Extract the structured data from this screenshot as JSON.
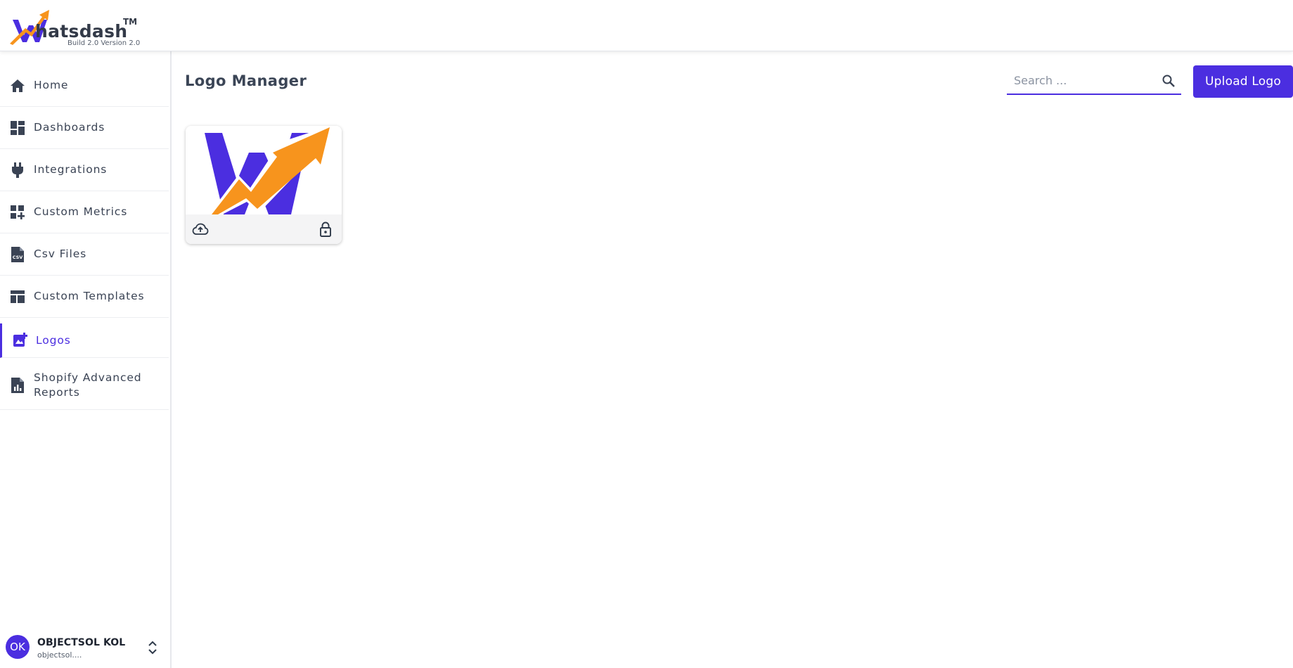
{
  "brand": {
    "name": "hatsdash",
    "tm": "TM",
    "build": "Build 2.0 Version 2.0",
    "colors": {
      "primary": "#4b2ee0",
      "accent": "#f7941d"
    }
  },
  "sidebar": {
    "items": [
      {
        "label": "Home",
        "icon": "home-icon"
      },
      {
        "label": "Dashboards",
        "icon": "dashboard-icon"
      },
      {
        "label": "Integrations",
        "icon": "plug-icon"
      },
      {
        "label": "Custom Metrics",
        "icon": "add-widget-icon"
      },
      {
        "label": "Csv Files",
        "icon": "csv-file-icon"
      },
      {
        "label": "Custom Templates",
        "icon": "template-icon"
      },
      {
        "label": "Logos",
        "icon": "logo-image-icon",
        "active": true
      },
      {
        "label": "Shopify Advanced Reports",
        "icon": "report-file-icon"
      }
    ]
  },
  "user": {
    "initials": "OK",
    "name": "OBJECTSOL KOL",
    "email": "objectsol...."
  },
  "main": {
    "title": "Logo Manager",
    "search": {
      "placeholder": "Search ..."
    },
    "upload_label": "Upload Logo",
    "logos": [
      {
        "icons": [
          "cloud-upload-icon",
          "lock-open-icon"
        ]
      }
    ]
  }
}
